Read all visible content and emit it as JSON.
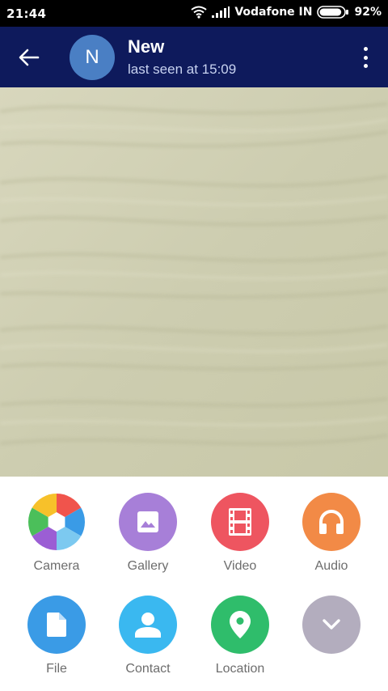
{
  "status_bar": {
    "time": "21:44",
    "carrier": "Vodafone IN",
    "battery": "92%",
    "battery_level": 0.92
  },
  "header": {
    "avatar_letter": "N",
    "title": "New",
    "subtitle": "last seen at 15:09"
  },
  "attach_options": {
    "camera": "Camera",
    "gallery": "Gallery",
    "video": "Video",
    "audio": "Audio",
    "file": "File",
    "contact": "Contact",
    "location": "Location"
  },
  "colors": {
    "header_bg": "#0e1a5c",
    "gallery": "#a77fd8",
    "video": "#ee5560",
    "audio": "#f28a46",
    "file": "#3a9be6",
    "contact": "#3ab8f0",
    "location": "#2fbd6b",
    "more": "#b3adbe"
  }
}
